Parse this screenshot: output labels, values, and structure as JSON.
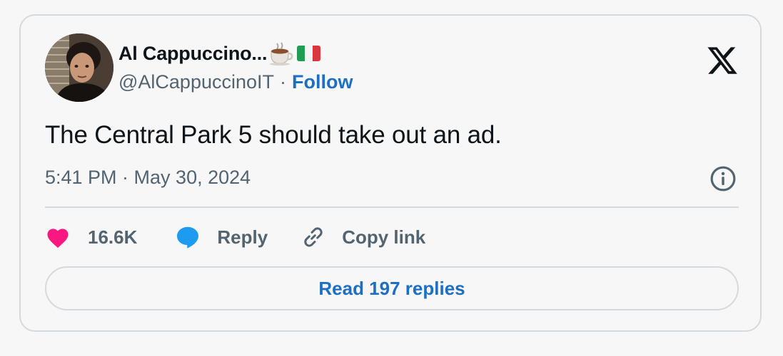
{
  "author": {
    "display_name": "Al Cappuccino...",
    "emoji": [
      "coffee-cup-emoji",
      "italy-flag-emoji"
    ],
    "handle": "@AlCappuccinoIT",
    "separator": "·",
    "follow_label": "Follow"
  },
  "tweet": {
    "text": "The Central Park 5 should take out an ad.",
    "timestamp": "5:41 PM · May 30, 2024"
  },
  "actions": {
    "likes_count": "16.6K",
    "reply_label": "Reply",
    "copy_link_label": "Copy link"
  },
  "read_replies_label": "Read 197 replies",
  "icons": {
    "brand": "x-logo-icon",
    "info": "info-icon",
    "like": "heart-icon",
    "reply": "speech-bubble-icon",
    "copy": "link-icon"
  },
  "colors": {
    "like": "#f91880",
    "reply": "#1d9bf0",
    "link_accent": "#1d6fc4",
    "text": "#0f1419",
    "muted": "#536471",
    "border": "#d6dadd"
  }
}
